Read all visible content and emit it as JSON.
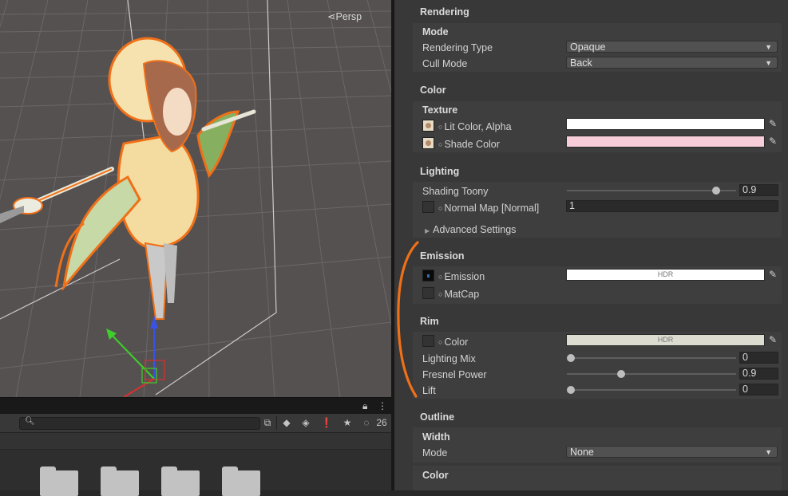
{
  "scene": {
    "view_label": "Persp"
  },
  "project": {
    "search_placeholder": "",
    "hidden_count": "26",
    "folders": [
      "",
      "",
      "",
      "",
      ""
    ]
  },
  "inspector": {
    "rendering": {
      "header": "Rendering",
      "mode_header": "Mode",
      "rendering_type_label": "Rendering Type",
      "rendering_type_value": "Opaque",
      "cull_mode_label": "Cull Mode",
      "cull_mode_value": "Back"
    },
    "color": {
      "header": "Color",
      "texture_header": "Texture",
      "lit_color_label": "Lit Color, Alpha",
      "lit_color_hex": "#ffffff",
      "shade_color_label": "Shade Color",
      "shade_color_hex": "#f6cdd8"
    },
    "lighting": {
      "header": "Lighting",
      "shading_toony_label": "Shading Toony",
      "shading_toony_value": "0.9",
      "normal_map_label": "Normal Map [Normal]",
      "normal_map_value": "1",
      "advanced_label": "Advanced Settings"
    },
    "emission": {
      "header": "Emission",
      "emission_label": "Emission",
      "emission_hdr": "HDR",
      "emission_hex": "#ffffff",
      "matcap_label": "MatCap"
    },
    "rim": {
      "header": "Rim",
      "color_label": "Color",
      "color_hdr": "HDR",
      "color_hex": "#dcdcd0",
      "lighting_mix_label": "Lighting Mix",
      "lighting_mix_value": "0",
      "fresnel_power_label": "Fresnel Power",
      "fresnel_power_value": "0.9",
      "lift_label": "Lift",
      "lift_value": "0"
    },
    "outline": {
      "header": "Outline",
      "width_header": "Width",
      "mode_label": "Mode",
      "mode_value": "None",
      "color_header": "Color"
    }
  },
  "colors": {
    "annotation": "#f07018",
    "selection_outline": "#f07018",
    "inspector_bg": "#383838"
  }
}
